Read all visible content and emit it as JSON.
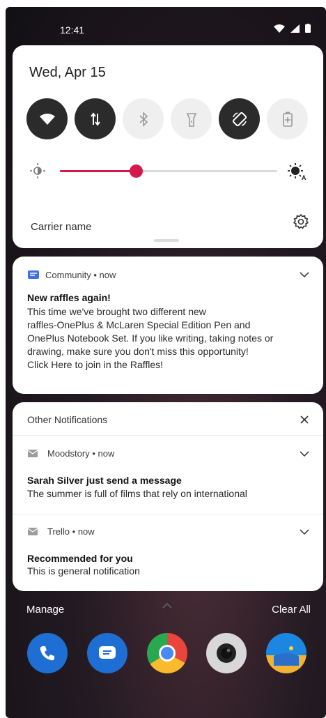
{
  "status_bar": {
    "time": "12:41"
  },
  "quick_settings": {
    "date": "Wed, Apr 15",
    "brightness_level": 0.35,
    "carrier": "Carrier name",
    "tiles": [
      {
        "icon": "wifi-icon",
        "on": true
      },
      {
        "icon": "data-transfer-icon",
        "on": true
      },
      {
        "icon": "bluetooth-icon",
        "on": false
      },
      {
        "icon": "flashlight-icon",
        "on": false
      },
      {
        "icon": "auto-rotate-icon",
        "on": true
      },
      {
        "icon": "battery-saver-icon",
        "on": false
      }
    ]
  },
  "community": {
    "app": "Community",
    "time": "now",
    "title": "New raffles again!",
    "body_lines": [
      "This time we've brought two different new",
      "raffles-OnePlus & McLaren Special Edition Pen and",
      "OnePlus Notebook Set. If you like writing, taking notes or",
      "drawing, make sure you don't miss this opportunity!",
      "Click Here to join in the Raffles!"
    ],
    "accent": "#3e6ee8"
  },
  "other": {
    "header": "Other Notifications",
    "items": [
      {
        "app": "Moodstory",
        "time": "now",
        "title": "Sarah Silver just send a message",
        "body": "The summer is full of films that rely on international"
      },
      {
        "app": "Trello",
        "time": "now",
        "title": "Recommended for you",
        "body": "This is general notification"
      }
    ]
  },
  "footer": {
    "manage": "Manage",
    "clear_all": "Clear All"
  },
  "dock": [
    {
      "icon": "phone-app-icon",
      "color": "#1f6ed4"
    },
    {
      "icon": "messages-app-icon",
      "color": "#1f6ed4"
    },
    {
      "icon": "chrome-app-icon",
      "color": "#e8453c"
    },
    {
      "icon": "camera-app-icon",
      "color": "#d8d8d8"
    },
    {
      "icon": "gallery-app-icon",
      "color": "#1f7fd8"
    }
  ]
}
